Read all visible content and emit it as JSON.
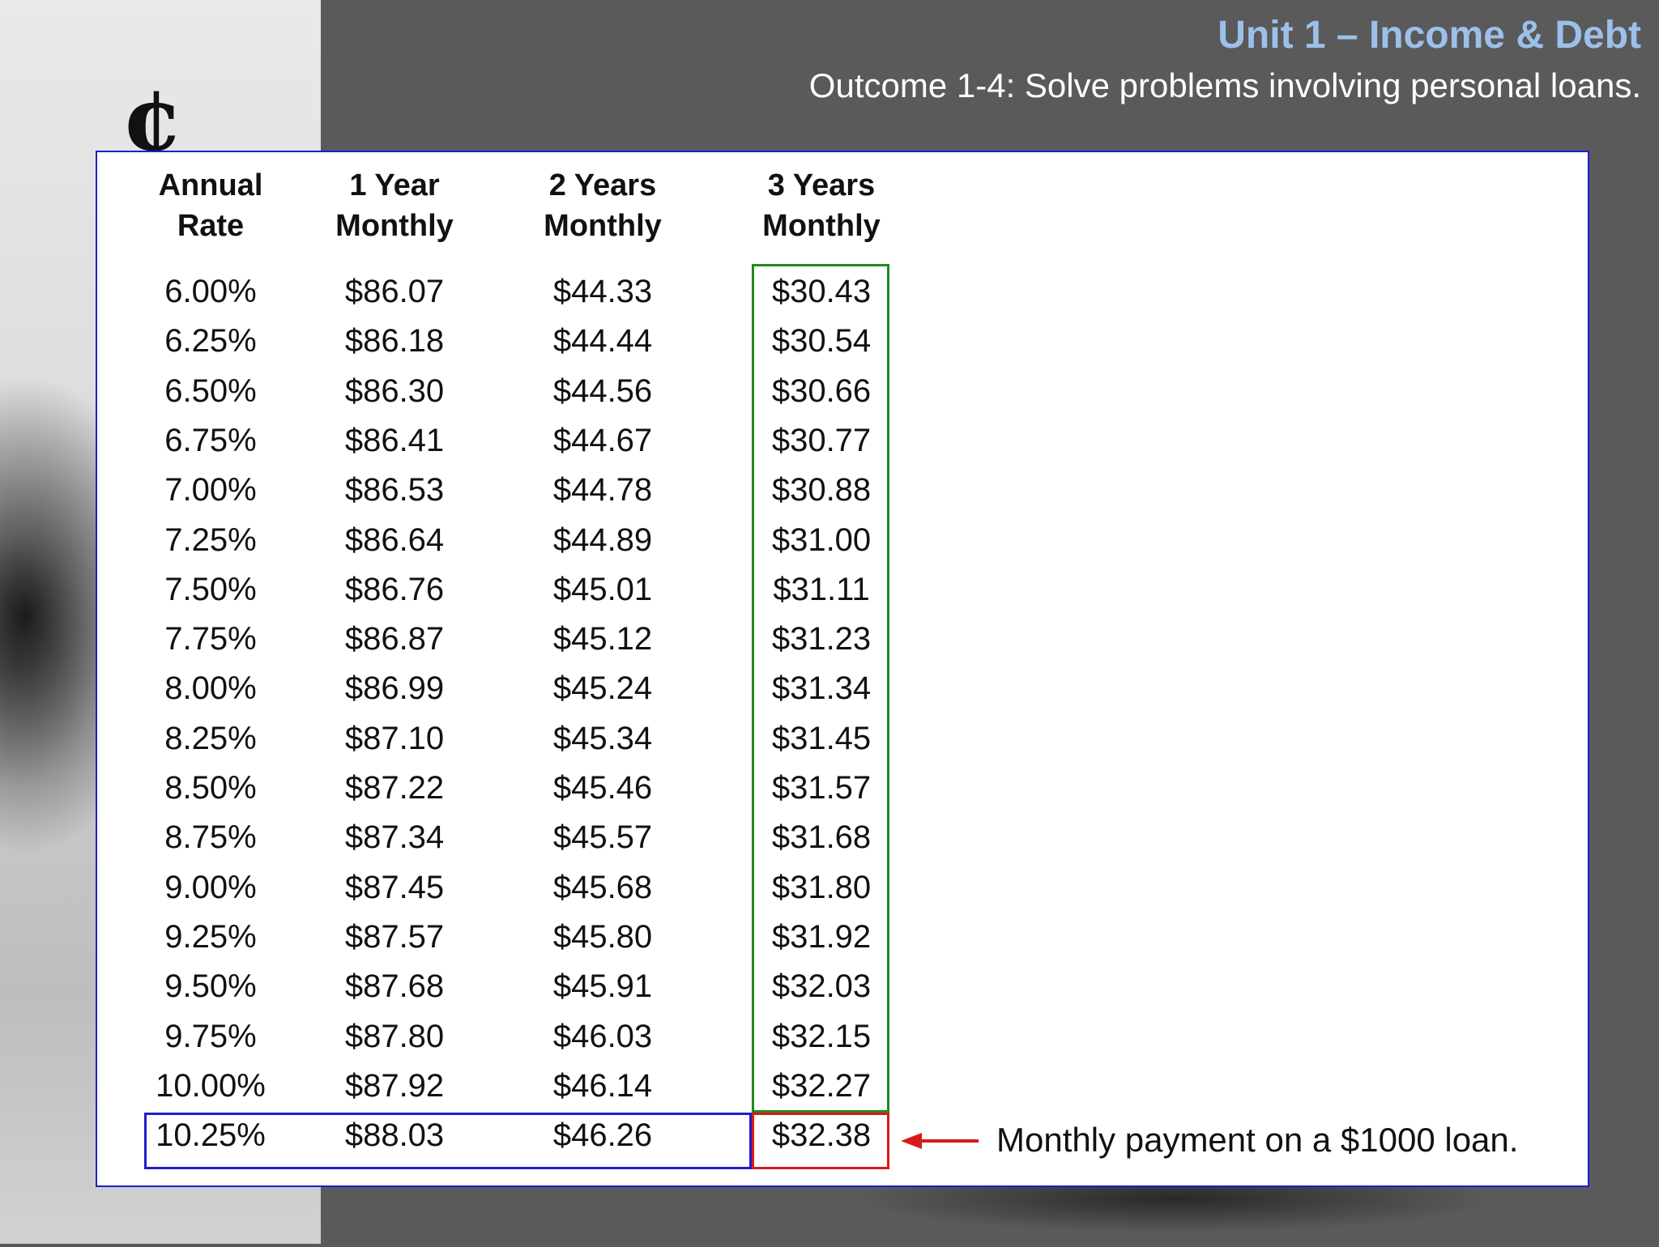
{
  "header": {
    "title": "Unit 1 – Income & Debt",
    "subtitle": "Outcome 1-4:  Solve problems involving personal loans."
  },
  "decor": {
    "cent_glyph": "¢"
  },
  "table": {
    "columns": [
      {
        "line1": "Annual",
        "line2": "Rate"
      },
      {
        "line1": "1 Year",
        "line2": "Monthly"
      },
      {
        "line1": "2 Years",
        "line2": "Monthly"
      },
      {
        "line1": "3 Years",
        "line2": "Monthly"
      }
    ],
    "rows": [
      [
        "6.00%",
        "$86.07",
        "$44.33",
        "$30.43"
      ],
      [
        "6.25%",
        "$86.18",
        "$44.44",
        "$30.54"
      ],
      [
        "6.50%",
        "$86.30",
        "$44.56",
        "$30.66"
      ],
      [
        "6.75%",
        "$86.41",
        "$44.67",
        "$30.77"
      ],
      [
        "7.00%",
        "$86.53",
        "$44.78",
        "$30.88"
      ],
      [
        "7.25%",
        "$86.64",
        "$44.89",
        "$31.00"
      ],
      [
        "7.50%",
        "$86.76",
        "$45.01",
        "$31.11"
      ],
      [
        "7.75%",
        "$86.87",
        "$45.12",
        "$31.23"
      ],
      [
        "8.00%",
        "$86.99",
        "$45.24",
        "$31.34"
      ],
      [
        "8.25%",
        "$87.10",
        "$45.34",
        "$31.45"
      ],
      [
        "8.50%",
        "$87.22",
        "$45.46",
        "$31.57"
      ],
      [
        "8.75%",
        "$87.34",
        "$45.57",
        "$31.68"
      ],
      [
        "9.00%",
        "$87.45",
        "$45.68",
        "$31.80"
      ],
      [
        "9.25%",
        "$87.57",
        "$45.80",
        "$31.92"
      ],
      [
        "9.50%",
        "$87.68",
        "$45.91",
        "$32.03"
      ],
      [
        "9.75%",
        "$87.80",
        "$46.03",
        "$32.15"
      ],
      [
        "10.00%",
        "$87.92",
        "$46.14",
        "$32.27"
      ],
      [
        "10.25%",
        "$88.03",
        "$46.26",
        "$32.38"
      ]
    ],
    "annotation": "Monthly payment on a $1000 loan."
  },
  "colors": {
    "title": "#9cc0ea",
    "highlight_column": "#1f8a1f",
    "highlight_row": "#1e1ecc",
    "highlight_cell": "#d81a1a"
  }
}
